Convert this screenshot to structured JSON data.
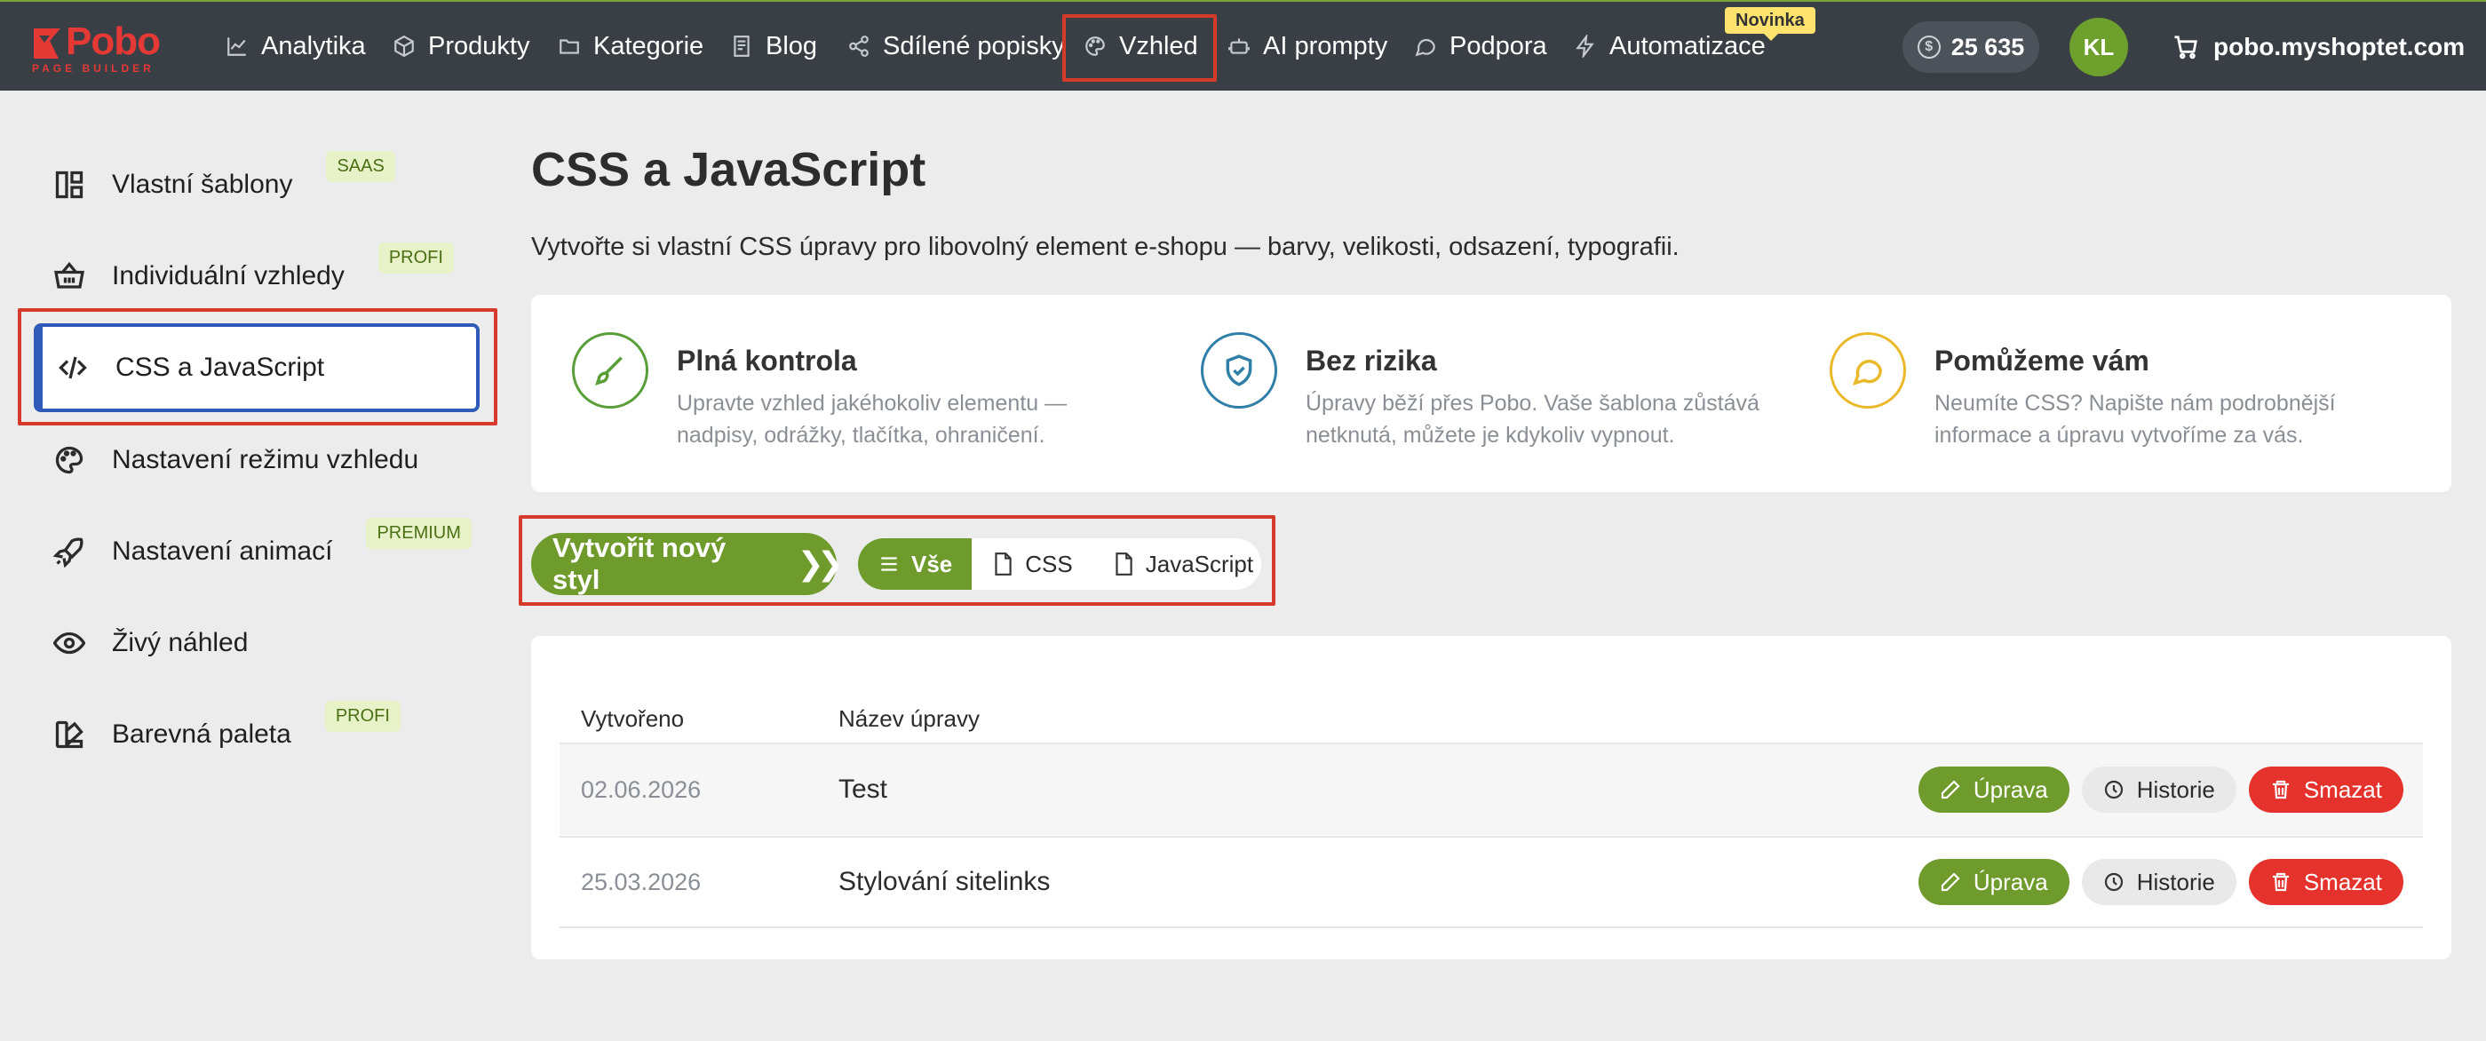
{
  "logo": {
    "word": "Pobo",
    "sub": "PAGE BUILDER"
  },
  "nav": [
    {
      "label": "Analytika",
      "icon": "chart-line-icon"
    },
    {
      "label": "Produkty",
      "icon": "box-icon"
    },
    {
      "label": "Kategorie",
      "icon": "folder-icon"
    },
    {
      "label": "Blog",
      "icon": "document-icon"
    },
    {
      "label": "Sdílené popisky",
      "icon": "share-icon"
    },
    {
      "label": "Vzhled",
      "icon": "palette-icon"
    },
    {
      "label": "AI prompty",
      "icon": "robot-icon"
    },
    {
      "label": "Podpora",
      "icon": "chat-icon"
    },
    {
      "label": "Automatizace",
      "icon": "bolt-icon"
    }
  ],
  "badge_new": "Novinka",
  "credits": {
    "value": "25 635",
    "icon": "coin-icon"
  },
  "user": {
    "initials": "KL"
  },
  "shop": {
    "domain": "pobo.myshoptet.com",
    "icon": "cart-icon"
  },
  "sidebar": [
    {
      "label": "Vlastní šablony",
      "badge": "SAAS",
      "icon": "layout-icon"
    },
    {
      "label": "Individuální vzhledy",
      "badge": "PROFI",
      "icon": "basket-icon"
    },
    {
      "label": "CSS a JavaScript",
      "badge": "",
      "icon": "code-icon"
    },
    {
      "label": "Nastavení režimu vzhledu",
      "badge": "",
      "icon": "palette-icon"
    },
    {
      "label": "Nastavení animací",
      "badge": "PREMIUM",
      "icon": "rocket-icon"
    },
    {
      "label": "Živý náhled",
      "badge": "",
      "icon": "eye-icon"
    },
    {
      "label": "Barevná paleta",
      "badge": "PROFI",
      "icon": "swatch-icon"
    }
  ],
  "page": {
    "title": "CSS a JavaScript",
    "description": "Vytvořte si vlastní CSS úpravy pro libovolný element e-shopu — barvy, velikosti, odsazení, typografii."
  },
  "features": [
    {
      "title": "Plná kontrola",
      "text": "Upravte vzhled jakéhokoliv elementu — nadpisy, odrážky, tlačítka, ohraničení.",
      "icon": "brush-icon",
      "color": "#5a9e3a"
    },
    {
      "title": "Bez rizika",
      "text": "Úpravy běží přes Pobo. Vaše šablona zůstává netknutá, můžete je kdykoliv vypnout.",
      "icon": "shield-check-icon",
      "color": "#2f7fa8"
    },
    {
      "title": "Pomůžeme vám",
      "text": "Neumíte CSS? Napište nám podrobnější informace a úpravu vytvoříme za vás.",
      "icon": "chat-bubble-icon",
      "color": "#e9b92a"
    }
  ],
  "actions": {
    "create_label": "Vytvořit nový styl",
    "filters": [
      {
        "label": "Vše",
        "icon": "list-icon",
        "active": true
      },
      {
        "label": "CSS",
        "icon": "css-file-icon",
        "active": false
      },
      {
        "label": "JavaScript",
        "icon": "js-file-icon",
        "active": false
      }
    ]
  },
  "table": {
    "columns": [
      "Vytvořeno",
      "Název úpravy"
    ],
    "rows": [
      {
        "date": "02.06.2026",
        "name": "Test"
      },
      {
        "date": "25.03.2026",
        "name": "Stylování sitelinks"
      }
    ],
    "buttons": {
      "edit": "Úprava",
      "history": "Historie",
      "delete": "Smazat"
    }
  },
  "colors": {
    "accent": "#6f9a2c",
    "nav_bg": "#3a3f46",
    "danger": "#e5322d",
    "highlight": "#d63a2a",
    "active_border": "#2f5ab8"
  }
}
